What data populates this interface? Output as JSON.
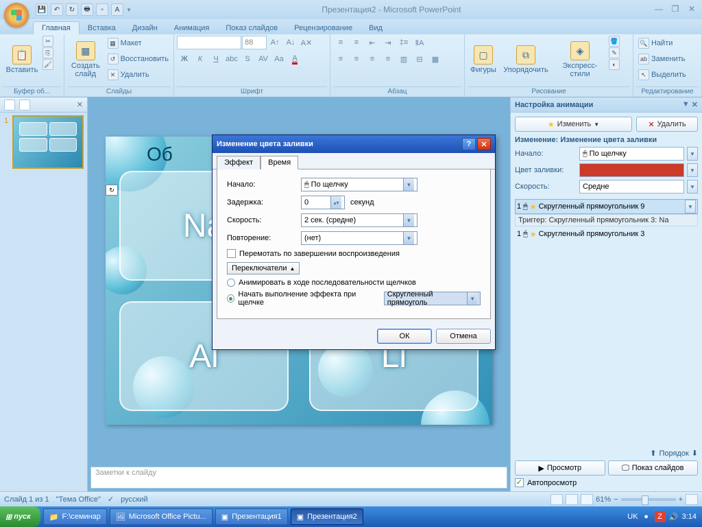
{
  "title": "Презентация2 - Microsoft PowerPoint",
  "ribbon": {
    "tabs": [
      "Главная",
      "Вставка",
      "Дизайн",
      "Анимация",
      "Показ слайдов",
      "Рецензирование",
      "Вид"
    ],
    "active": 0,
    "groups": {
      "clipboard": {
        "label": "Буфер об...",
        "paste": "Вставить"
      },
      "slides": {
        "label": "Слайды",
        "new": "Создать\nслайд",
        "layout": "Макет",
        "reset": "Восстановить",
        "delete": "Удалить"
      },
      "font": {
        "label": "Шрифт",
        "size": "88"
      },
      "para": {
        "label": "Абзац"
      },
      "drawing": {
        "label": "Рисование",
        "shapes": "Фигуры",
        "arrange": "Упорядочить",
        "styles": "Экспресс-стили"
      },
      "editing": {
        "label": "Редактирование",
        "find": "Найти",
        "replace": "Заменить",
        "select": "Выделить"
      }
    }
  },
  "slide": {
    "tiles": [
      "Na",
      "",
      "Al",
      "Li"
    ],
    "title": "Об",
    "notes": "Заметки к слайду"
  },
  "dialog": {
    "title": "Изменение цвета заливки",
    "tabs": [
      "Эффект",
      "Время"
    ],
    "active": 1,
    "start_label": "Начало:",
    "start_value": "По щелчку",
    "delay_label": "Задержка:",
    "delay_value": "0",
    "delay_unit": "секунд",
    "speed_label": "Скорость:",
    "speed_value": "2 сек. (средне)",
    "repeat_label": "Повторение:",
    "repeat_value": "(нет)",
    "rewind": "Перемотать по завершении воспроизведения",
    "triggers": "Переключатели",
    "radio1": "Анимировать в ходе последовательности щелчков",
    "radio2": "Начать выполнение эффекта при щелчке",
    "trigger_obj": "Скругленный прямоуголь",
    "ok": "ОК",
    "cancel": "Отмена"
  },
  "anim": {
    "title": "Настройка анимации",
    "change": "Изменить",
    "delete": "Удалить",
    "sub": "Изменение: Изменение цвета заливки",
    "start_label": "Начало:",
    "start_value": "По щелчку",
    "fill_label": "Цвет заливки:",
    "speed_label": "Скорость:",
    "speed_value": "Средне",
    "item1_num": "1",
    "item1": "Скругленный прямоугольник 9",
    "trigger": "Триггер: Скругленный прямоугольник 3: Na",
    "item2_num": "1",
    "item2": "Скругленный прямоугольник 3",
    "order": "Порядок",
    "preview": "Просмотр",
    "show": "Показ слайдов",
    "auto": "Автопросмотр"
  },
  "status": {
    "slide": "Слайд 1 из 1",
    "theme": "\"Тема Office\"",
    "lang": "русский",
    "zoom": "61%"
  },
  "taskbar": {
    "start": "пуск",
    "items": [
      "F:\\семинар",
      "Microsoft Office Pictu...",
      "Презентация1",
      "Презентация2"
    ],
    "active": 3,
    "lang": "UK",
    "time": "3:14"
  }
}
